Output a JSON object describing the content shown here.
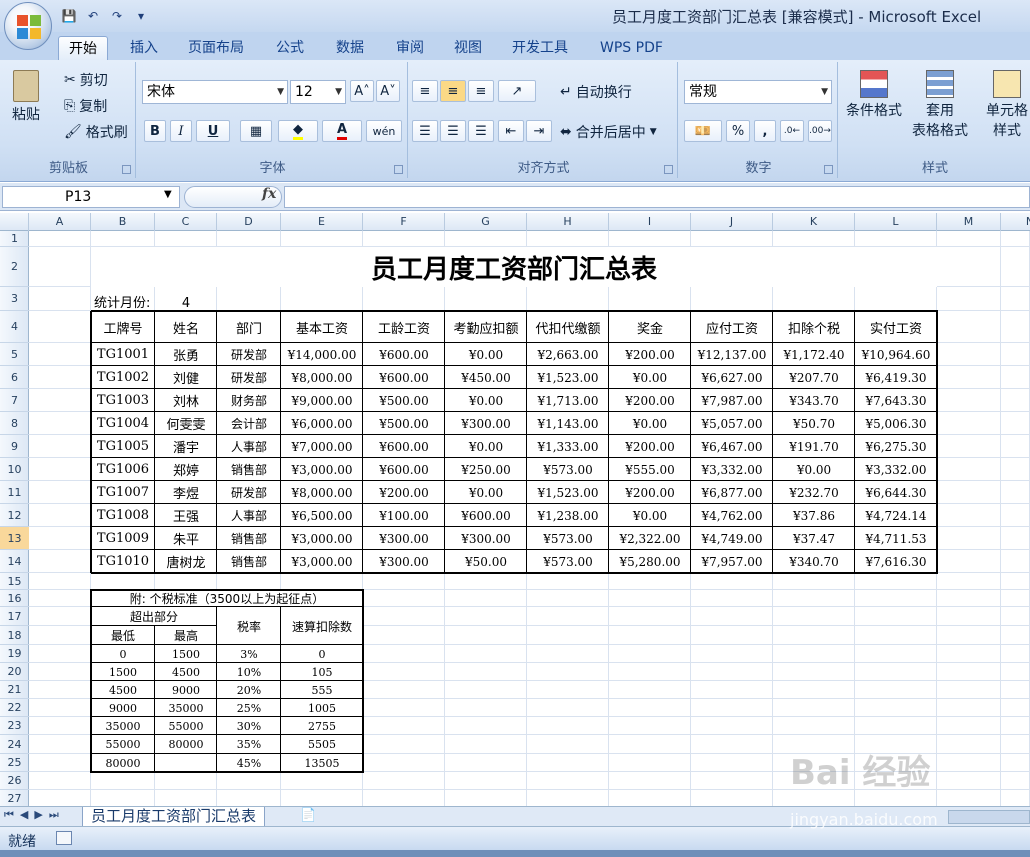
{
  "window": {
    "title": "员工月度工资部门汇总表  [兼容模式] - Microsoft Excel"
  },
  "tabs": [
    "开始",
    "插入",
    "页面布局",
    "公式",
    "数据",
    "审阅",
    "视图",
    "开发工具",
    "WPS PDF"
  ],
  "ribbon": {
    "clipboard": {
      "label": "剪贴板",
      "paste": "粘贴",
      "cut": "剪切",
      "copy": "复制",
      "format_painter": "格式刷"
    },
    "font": {
      "label": "字体",
      "font_name": "宋体",
      "font_size": "12",
      "bold": "B",
      "italic": "I",
      "underline": "U",
      "font_color": "A",
      "phonetic": "wén"
    },
    "alignment": {
      "label": "对齐方式",
      "wrap": "自动换行",
      "merge": "合并后居中"
    },
    "number": {
      "label": "数字",
      "format": "常规",
      "percent": "%",
      "comma": ","
    },
    "styles": {
      "label": "样式",
      "conditional": "条件格式",
      "table_format_1": "套用",
      "table_format_2": "表格格式",
      "cell_styles_1": "单元格",
      "cell_styles_2": "样式"
    }
  },
  "formula_bar": {
    "name_box": "P13",
    "fx": "fx",
    "formula": ""
  },
  "columns": [
    "A",
    "B",
    "C",
    "D",
    "E",
    "F",
    "G",
    "H",
    "I",
    "J",
    "K",
    "L",
    "M",
    "N"
  ],
  "rows": [
    "1",
    "2",
    "3",
    "4",
    "5",
    "6",
    "7",
    "8",
    "9",
    "10",
    "11",
    "12",
    "13",
    "14",
    "15",
    "16",
    "17",
    "18",
    "19",
    "20",
    "21",
    "22",
    "23",
    "24",
    "25",
    "26",
    "27"
  ],
  "selected_row": "13",
  "sheet": {
    "title": "员工月度工资部门汇总表",
    "month_label": "统计月份:",
    "month_value": "4",
    "headers": [
      "工牌号",
      "姓名",
      "部门",
      "基本工资",
      "工龄工资",
      "考勤应扣额",
      "代扣代缴额",
      "奖金",
      "应付工资",
      "扣除个税",
      "实付工资"
    ],
    "rows": [
      [
        "TG1001",
        "张勇",
        "研发部",
        "¥14,000.00",
        "¥600.00",
        "¥0.00",
        "¥2,663.00",
        "¥200.00",
        "¥12,137.00",
        "¥1,172.40",
        "¥10,964.60"
      ],
      [
        "TG1002",
        "刘健",
        "研发部",
        "¥8,000.00",
        "¥600.00",
        "¥450.00",
        "¥1,523.00",
        "¥0.00",
        "¥6,627.00",
        "¥207.70",
        "¥6,419.30"
      ],
      [
        "TG1003",
        "刘林",
        "财务部",
        "¥9,000.00",
        "¥500.00",
        "¥0.00",
        "¥1,713.00",
        "¥200.00",
        "¥7,987.00",
        "¥343.70",
        "¥7,643.30"
      ],
      [
        "TG1004",
        "何雯雯",
        "会计部",
        "¥6,000.00",
        "¥500.00",
        "¥300.00",
        "¥1,143.00",
        "¥0.00",
        "¥5,057.00",
        "¥50.70",
        "¥5,006.30"
      ],
      [
        "TG1005",
        "潘宇",
        "人事部",
        "¥7,000.00",
        "¥600.00",
        "¥0.00",
        "¥1,333.00",
        "¥200.00",
        "¥6,467.00",
        "¥191.70",
        "¥6,275.30"
      ],
      [
        "TG1006",
        "郑婷",
        "销售部",
        "¥3,000.00",
        "¥600.00",
        "¥250.00",
        "¥573.00",
        "¥555.00",
        "¥3,332.00",
        "¥0.00",
        "¥3,332.00"
      ],
      [
        "TG1007",
        "李煜",
        "研发部",
        "¥8,000.00",
        "¥200.00",
        "¥0.00",
        "¥1,523.00",
        "¥200.00",
        "¥6,877.00",
        "¥232.70",
        "¥6,644.30"
      ],
      [
        "TG1008",
        "王强",
        "人事部",
        "¥6,500.00",
        "¥100.00",
        "¥600.00",
        "¥1,238.00",
        "¥0.00",
        "¥4,762.00",
        "¥37.86",
        "¥4,724.14"
      ],
      [
        "TG1009",
        "朱平",
        "销售部",
        "¥3,000.00",
        "¥300.00",
        "¥300.00",
        "¥573.00",
        "¥2,322.00",
        "¥4,749.00",
        "¥37.47",
        "¥4,711.53"
      ],
      [
        "TG1010",
        "唐树龙",
        "销售部",
        "¥3,000.00",
        "¥300.00",
        "¥50.00",
        "¥573.00",
        "¥5,280.00",
        "¥7,957.00",
        "¥340.70",
        "¥7,616.30"
      ]
    ],
    "tax_table": {
      "title": "附: 个税标准（3500以上为起征点）",
      "excess_label": "超出部分",
      "low_label": "最低",
      "high_label": "最高",
      "rate_label": "税率",
      "deduction_label": "速算扣除数",
      "rows": [
        [
          "0",
          "1500",
          "3%",
          "0"
        ],
        [
          "1500",
          "4500",
          "10%",
          "105"
        ],
        [
          "4500",
          "9000",
          "20%",
          "555"
        ],
        [
          "9000",
          "35000",
          "25%",
          "1005"
        ],
        [
          "35000",
          "55000",
          "30%",
          "2755"
        ],
        [
          "55000",
          "80000",
          "35%",
          "5505"
        ],
        [
          "80000",
          "",
          "45%",
          "13505"
        ]
      ]
    }
  },
  "sheet_tabs": [
    "员工月度工资部门汇总表"
  ],
  "status": {
    "ready": "就绪"
  },
  "watermark": {
    "text": "Bai 经验",
    "url": "jingyan.baidu.com"
  }
}
